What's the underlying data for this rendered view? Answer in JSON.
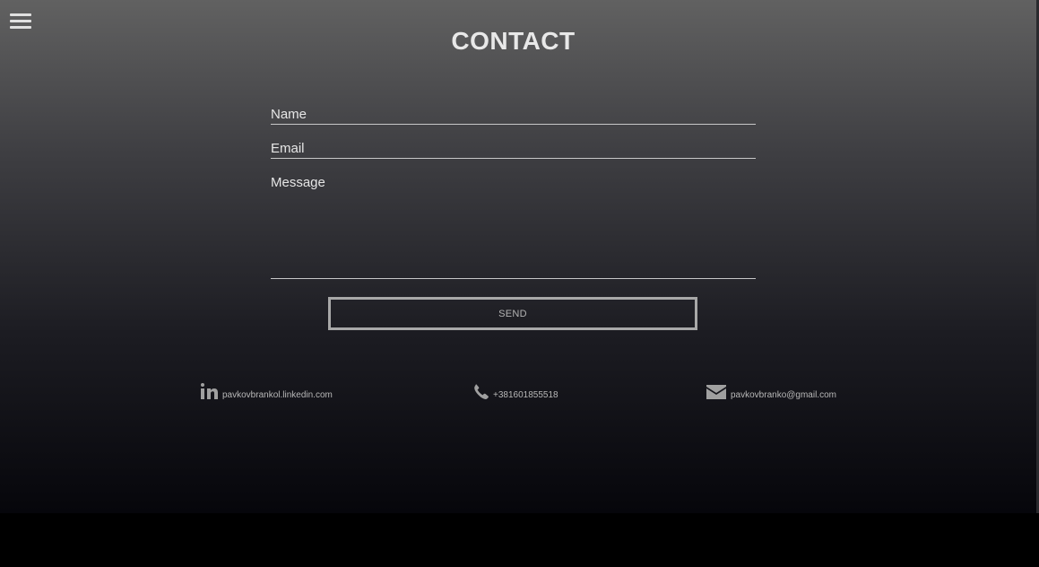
{
  "header": {
    "menu_icon": "hamburger-menu-icon",
    "title": "CONTACT"
  },
  "form": {
    "name_placeholder": "Name",
    "email_placeholder": "Email",
    "message_placeholder": "Message",
    "send_label": "SEND"
  },
  "contacts": {
    "linkedin": {
      "icon": "linkedin-icon",
      "text": "pavkovbrankol.linkedin.com"
    },
    "phone": {
      "icon": "phone-icon",
      "text": "+381601855518"
    },
    "email": {
      "icon": "envelope-icon",
      "text": "pavkovbranko@gmail.com"
    }
  },
  "colors": {
    "gradient_top": "#616161",
    "gradient_bottom": "#06060b",
    "text": "#e8e8e8",
    "button_border": "#a8a8a8"
  }
}
